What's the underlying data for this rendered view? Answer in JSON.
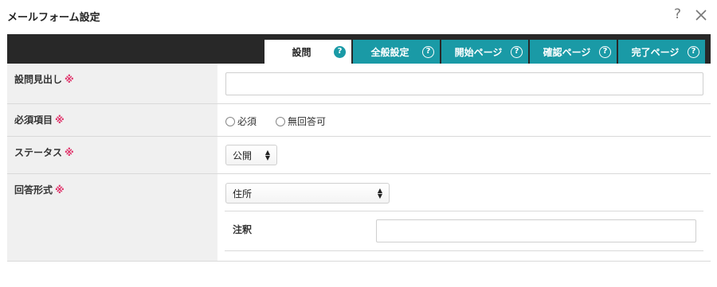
{
  "dialog": {
    "title": "メールフォーム設定",
    "help_glyph": "?",
    "close_glyph": "×"
  },
  "tabs": [
    {
      "label": "設問",
      "active": true
    },
    {
      "label": "全般設定",
      "active": false
    },
    {
      "label": "開始ページ",
      "active": false
    },
    {
      "label": "確認ページ",
      "active": false
    },
    {
      "label": "完了ページ",
      "active": false
    }
  ],
  "tab_help_glyph": "?",
  "required_mark": "※",
  "form": {
    "heading": {
      "label": "設問見出し",
      "value": ""
    },
    "required": {
      "label": "必須項目",
      "options": [
        "必須",
        "無回答可"
      ],
      "selected": null
    },
    "status": {
      "label": "ステータス",
      "value": "公開"
    },
    "answer_type": {
      "label": "回答形式",
      "value": "住所",
      "note": {
        "label": "注釈",
        "value": ""
      }
    }
  },
  "colors": {
    "accent": "#1a9aa6",
    "tabbar": "#282828",
    "required": "#e0336a",
    "label_bg": "#f0f0f0"
  }
}
